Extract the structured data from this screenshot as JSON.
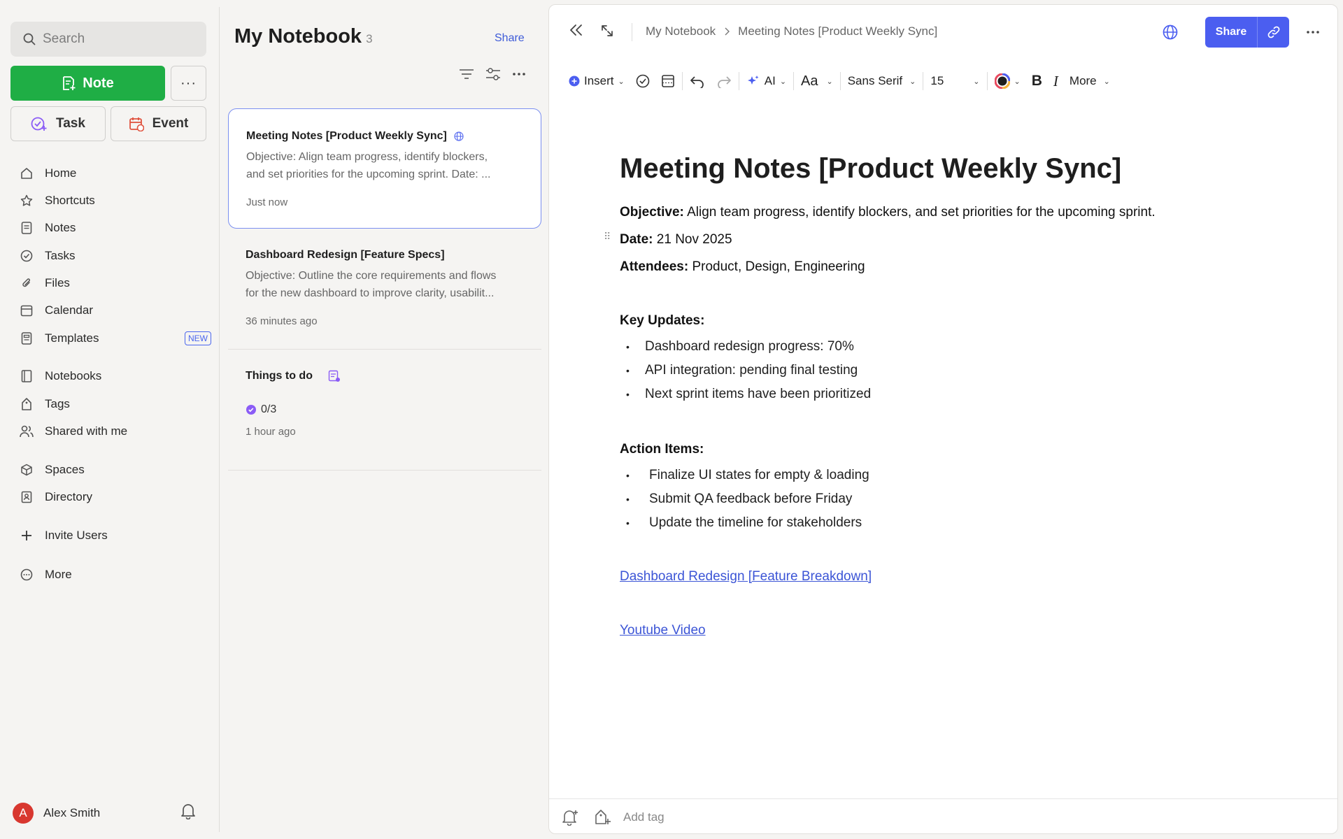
{
  "sidebar": {
    "search": {
      "placeholder": "Search"
    },
    "note_label": "Note",
    "more_label": "···",
    "task_label": "Task",
    "event_label": "Event",
    "nav": [
      {
        "label": "Home",
        "icon": "home-icon"
      },
      {
        "label": "Shortcuts",
        "icon": "star-icon"
      },
      {
        "label": "Notes",
        "icon": "note-icon"
      },
      {
        "label": "Tasks",
        "icon": "check-circle-icon"
      },
      {
        "label": "Files",
        "icon": "paperclip-icon"
      },
      {
        "label": "Calendar",
        "icon": "calendar-icon"
      },
      {
        "label": "Templates",
        "icon": "template-icon",
        "badge": "NEW"
      },
      {
        "label": "Notebooks",
        "icon": "notebook-icon"
      },
      {
        "label": "Tags",
        "icon": "tag-icon"
      },
      {
        "label": "Shared with me",
        "icon": "shared-icon"
      },
      {
        "label": "Spaces",
        "icon": "cube-icon"
      },
      {
        "label": "Directory",
        "icon": "directory-icon"
      },
      {
        "label": "Invite Users",
        "icon": "plus-icon"
      },
      {
        "label": "More",
        "icon": "more-circle-icon"
      }
    ],
    "user": {
      "initial": "A",
      "name": "Alex Smith"
    }
  },
  "note_list": {
    "title": "My Notebook",
    "count": "3",
    "share_label": "Share",
    "notes": [
      {
        "title": "Meeting Notes [Product Weekly Sync]",
        "preview_1": "Objective: Align team progress, identify blockers,",
        "preview_2": "and set priorities for the upcoming sprint. Date: ...",
        "time": "Just now"
      },
      {
        "title": "Dashboard Redesign [Feature Specs]",
        "preview_1": "Objective: Outline the core requirements and flows",
        "preview_2": "for the new dashboard to improve clarity, usabilit...",
        "time": "36 minutes ago"
      },
      {
        "title": "Things to do",
        "progress": "0/3",
        "time": "1 hour ago"
      }
    ]
  },
  "editor": {
    "breadcrumb": [
      "My Notebook",
      "Meeting Notes [Product Weekly Sync]"
    ],
    "share_label": "Share",
    "toolbar": {
      "insert": "Insert",
      "ai": "AI",
      "font_size_icon": "Aa",
      "font_family": "Sans Serif",
      "font_size": "15",
      "bold": "B",
      "italic": "I",
      "more": "More"
    },
    "doc": {
      "title": "Meeting Notes [Product Weekly Sync]",
      "objective_label": "Objective:",
      "objective": " Align team progress, identify blockers, and set priorities for the upcoming sprint.",
      "date_label": "Date:",
      "date": " 21 Nov 2025",
      "attendees_label": "Attendees:",
      "attendees": " Product, Design, Engineering",
      "updates_heading": "Key Updates:",
      "updates": [
        "Dashboard redesign progress: 70%",
        "API integration: pending final testing",
        "Next sprint items have been prioritized"
      ],
      "actions_heading": "Action Items:",
      "actions": [
        "Finalize UI states for empty & loading",
        "Submit QA feedback before Friday",
        "Update the timeline for stakeholders"
      ],
      "link_1": "Dashboard Redesign [Feature Breakdown]",
      "link_2": "Youtube Video"
    },
    "footer": {
      "add_tag": "Add tag"
    }
  },
  "colors": {
    "accent": "#4b5ef0",
    "note_green": "#1fae45",
    "link": "#3c55d6",
    "avatar": "#d8372f"
  }
}
